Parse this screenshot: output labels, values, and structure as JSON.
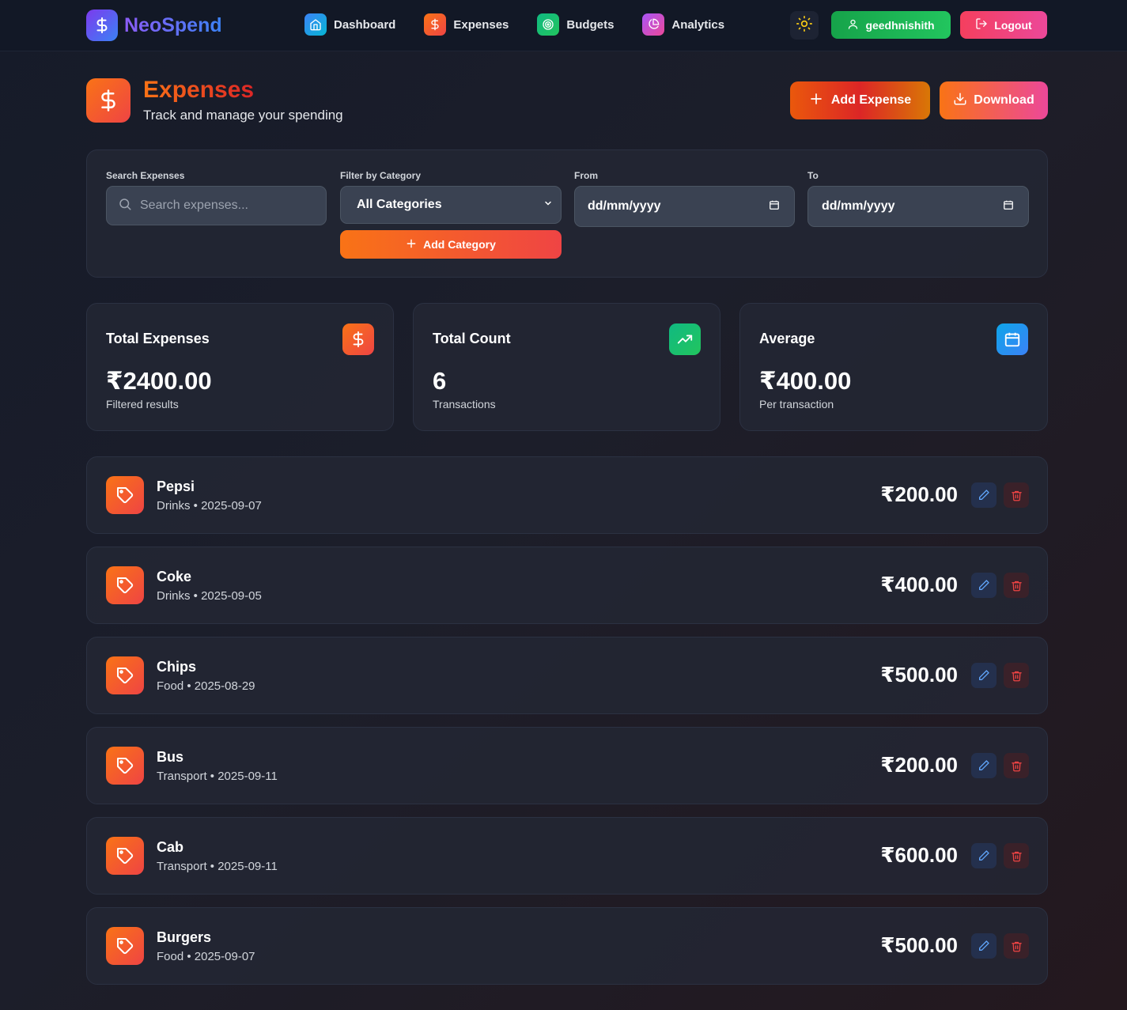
{
  "brand": {
    "name": "NeoSpend"
  },
  "nav": {
    "items": [
      {
        "label": "Dashboard",
        "icon": "home-icon"
      },
      {
        "label": "Expenses",
        "icon": "dollar-icon"
      },
      {
        "label": "Budgets",
        "icon": "target-icon"
      },
      {
        "label": "Analytics",
        "icon": "pie-chart-icon"
      }
    ],
    "user_label": "geedhnishith",
    "logout_label": "Logout"
  },
  "header": {
    "title": "Expenses",
    "subtitle": "Track and manage your spending",
    "add_expense_label": "Add Expense",
    "download_label": "Download"
  },
  "filters": {
    "search_label": "Search Expenses",
    "search_placeholder": "Search expenses...",
    "category_label": "Filter by Category",
    "category_value": "All Categories",
    "add_category_label": "Add Category",
    "from_label": "From",
    "from_value": "dd/mm/yyyy",
    "to_label": "To",
    "to_value": "dd/mm/yyyy"
  },
  "stats": [
    {
      "title": "Total Expenses",
      "value": "₹2400.00",
      "sub": "Filtered results",
      "icon": "dollar-icon"
    },
    {
      "title": "Total Count",
      "value": "6",
      "sub": "Transactions",
      "icon": "trending-up-icon"
    },
    {
      "title": "Average",
      "value": "₹400.00",
      "sub": "Per transaction",
      "icon": "calendar-icon"
    }
  ],
  "expenses": [
    {
      "name": "Pepsi",
      "meta": "Drinks • 2025-09-07",
      "amount": "₹200.00"
    },
    {
      "name": "Coke",
      "meta": "Drinks • 2025-09-05",
      "amount": "₹400.00"
    },
    {
      "name": "Chips",
      "meta": "Food • 2025-08-29",
      "amount": "₹500.00"
    },
    {
      "name": "Bus",
      "meta": "Transport • 2025-09-11",
      "amount": "₹200.00"
    },
    {
      "name": "Cab",
      "meta": "Transport • 2025-09-11",
      "amount": "₹600.00"
    },
    {
      "name": "Burgers",
      "meta": "Food • 2025-09-07",
      "amount": "₹500.00"
    }
  ],
  "colors": {
    "accent_orange": "#f97316",
    "accent_red": "#ef4444",
    "success_green": "#22c55e",
    "logout_pink": "#f43f5e",
    "background": "#1a1d29"
  }
}
